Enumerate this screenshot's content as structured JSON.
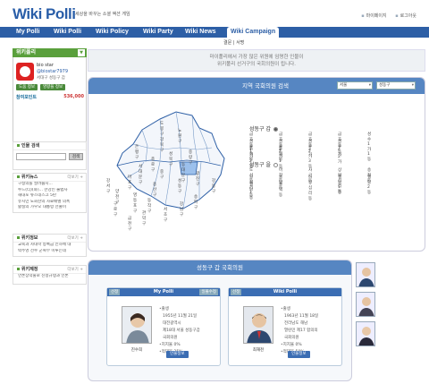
{
  "header": {
    "logo": "Wiki Polli",
    "tagline": "세상을 바꾸는 소셜 액션 게임",
    "links": [
      "마이페이지",
      "로그아웃"
    ]
  },
  "nav": {
    "tabs": [
      "My Polli",
      "Wiki Polli",
      "Wiki Policy",
      "Wiki Party",
      "Wiki News",
      "Wiki Campaign"
    ],
    "active": "Wiki Campaign",
    "subnav": [
      "결문",
      "서명"
    ]
  },
  "sidebar": {
    "title": "위키폴리",
    "user": {
      "name": "bio star",
      "id": "@biostar7979",
      "area": "서대구 성동구 갑"
    },
    "buttons": [
      "도움 정보",
      "영향을 정보"
    ],
    "points_label": "참여포인트",
    "points_value": "536,000",
    "search_title": "인물 검색",
    "search_btn": "검색",
    "search_placeholder": "",
    "news": {
      "title": "위키뉴스",
      "more": "더보기 +",
      "items": [
        "구청의를 살려줍시...",
        "누드(티)(와)... 한강인 불법사",
        "해대포 뉴스데스크 5탄",
        "유시민 노회찬의 자료배벌 의혹",
        "활실의 가우오 대통령 선출이"
      ]
    },
    "policy": {
      "title": "위키정보",
      "more": "더보기 +",
      "items": [
        "교육과 사대학 등록금 인하에 대",
        "박주영 선수 군복무 미루는데"
      ]
    },
    "party": {
      "title": "위키제정",
      "more": "더보기 +",
      "items": [
        "언론장악물로 진정규탱과 인론"
      ]
    }
  },
  "banner": {
    "line1": "마이폴리에서 가장 많은 위원에 임명한 인물이",
    "line2": "위키폴리 선거구의 국회의원이 됩니다."
  },
  "search": {
    "title": "지역 국회의원 검색",
    "select1": "서울",
    "select2": "성동구",
    "districts": [
      {
        "name": "성동구 갑",
        "selected": true,
        "dongs": [
          "금호동1가",
          "금호동2가",
          "금호동3가",
          "금호동4가",
          "성수1가1동",
          "성수1가2동",
          "성수2가1동",
          "성수2가3동",
          "성수동2가",
          "옥수동",
          "응봉동"
        ]
      },
      {
        "name": "성동구 을",
        "selected": false,
        "dongs": [
          "도선동",
          "마장동",
          "사근동",
          "상왕십리동",
          "송정동",
          "왕십리1동",
          "용답동",
          "하왕십리동",
          "행당1동",
          "행당2동",
          "행당동",
          "홍익동"
        ]
      }
    ],
    "map_labels": [
      "도봉구",
      "노원구",
      "강북구",
      "성북구",
      "은평구",
      "종로구",
      "중랑구",
      "동대문구",
      "서대문구",
      "마포구",
      "중구",
      "광진구",
      "성동구",
      "강서구",
      "용산구",
      "양천구",
      "영등포구",
      "동작구",
      "강동구",
      "송파구",
      "구로구",
      "관악구",
      "서초구",
      "강남구",
      "금천구"
    ]
  },
  "result": {
    "title": "성동구 갑 국회의원",
    "cards": [
      {
        "tag": "선정",
        "header": "My Polli",
        "tag2": "일몰수정",
        "name": "진수희",
        "info": [
          "출생",
          "1955년 11월 21일",
          "대전광역시",
          "제18대 서울 성동구갑",
          "국회의원",
          "지지율 0%",
          "적대율 25%"
        ],
        "button": "인물정보"
      },
      {
        "tag": "선정",
        "header": "Wiki Polli",
        "tag2": "",
        "name": "최재천",
        "info": [
          "출생",
          "1963년 11월 18일",
          "전라남도 해남",
          "열린민 제17 합의의",
          "국회의원",
          "지지율 0%",
          "적대율 50%"
        ],
        "button": "인물정보"
      }
    ]
  },
  "colors": {
    "brand_blue": "#2d5fa6",
    "green": "#5aa03c",
    "section_blue": "#5686c2"
  }
}
